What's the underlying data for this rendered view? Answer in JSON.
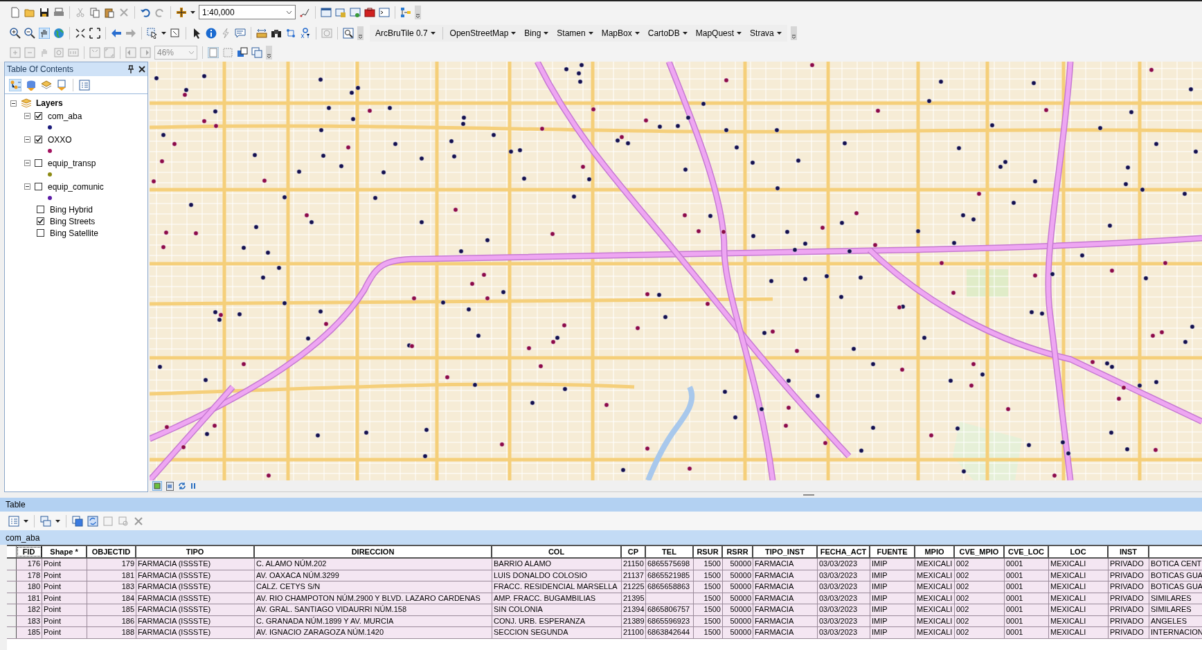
{
  "toolbar": {
    "scale": "1:40,000",
    "zoom": "46%",
    "menus": [
      "ArcBruTile 0.7",
      "OpenStreetMap",
      "Bing",
      "Stamen",
      "MapBox",
      "CartoDB",
      "MapQuest",
      "Strava"
    ]
  },
  "toc": {
    "title": "Table Of Contents",
    "root": "Layers",
    "layers": [
      {
        "kind": "layer",
        "label": "com_aba",
        "checked": true,
        "expanded": true,
        "color": "#1a1a7a"
      },
      {
        "kind": "layer",
        "label": "OXXO",
        "checked": true,
        "expanded": true,
        "color": "#a3125f"
      },
      {
        "kind": "layer",
        "label": "equip_transp",
        "checked": false,
        "expanded": true,
        "color": "#8c8a12"
      },
      {
        "kind": "layer",
        "label": "equip_comunic",
        "checked": false,
        "expanded": true,
        "color": "#5b1aa6"
      },
      {
        "kind": "basemap",
        "label": "Bing Hybrid",
        "checked": false
      },
      {
        "kind": "basemap",
        "label": "Bing Streets",
        "checked": true
      },
      {
        "kind": "basemap",
        "label": "Bing Satellite",
        "checked": false
      }
    ]
  },
  "table": {
    "title": "Table",
    "tab": "com_aba",
    "columns": [
      "FID",
      "Shape *",
      "OBJECTID",
      "TIPO",
      "DIRECCION",
      "COL",
      "CP",
      "TEL",
      "RSUR",
      "RSRR",
      "TIPO_INST",
      "FECHA_ACT",
      "FUENTE",
      "MPIO",
      "CVE_MPIO",
      "CVE_LOC",
      "LOC",
      "INST"
    ],
    "rows": [
      [
        "176",
        "Point",
        "179",
        "FARMACIA (ISSSTE)",
        "C. ALAMO NÚM.202",
        "BARRIO ALAMO",
        "21150",
        "6865575698",
        "1500",
        "50000",
        "FARMACIA",
        "03/03/2023",
        "IMIP",
        "MEXICALI",
        "002",
        "0001",
        "MEXICALI",
        "PRIVADO",
        "BOTICA CENT"
      ],
      [
        "178",
        "Point",
        "181",
        "FARMACIA (ISSSTE)",
        "AV. OAXACA NÚM.3299",
        "LUIS DONALDO COLOSIO",
        "21137",
        "6865521985",
        "1500",
        "50000",
        "FARMACIA",
        "03/03/2023",
        "IMIP",
        "MEXICALI",
        "002",
        "0001",
        "MEXICALI",
        "PRIVADO",
        "BOTICAS GUA"
      ],
      [
        "180",
        "Point",
        "183",
        "FARMACIA (ISSSTE)",
        "CALZ. CETYS S/N",
        "FRACC. RESIDENCIAL MARSELLA",
        "21225",
        "6865658863",
        "1500",
        "50000",
        "FARMACIA",
        "03/03/2023",
        "IMIP",
        "MEXICALI",
        "002",
        "0001",
        "MEXICALI",
        "PRIVADO",
        "BOTICAS GUA"
      ],
      [
        "181",
        "Point",
        "184",
        "FARMACIA (ISSSTE)",
        "AV. RIO CHAMPOTON NÚM.2900 Y BLVD. LAZARO CARDENAS",
        "AMP. FRACC. BUGAMBILIAS",
        "21395",
        "",
        "1500",
        "50000",
        "FARMACIA",
        "03/03/2023",
        "IMIP",
        "MEXICALI",
        "002",
        "0001",
        "MEXICALI",
        "PRIVADO",
        "SIMILARES"
      ],
      [
        "182",
        "Point",
        "185",
        "FARMACIA (ISSSTE)",
        "AV. GRAL. SANTIAGO VIDAURRI NÚM.158",
        "SIN COLONIA",
        "21394",
        "6865806757",
        "1500",
        "50000",
        "FARMACIA",
        "03/03/2023",
        "IMIP",
        "MEXICALI",
        "002",
        "0001",
        "MEXICALI",
        "PRIVADO",
        "SIMILARES"
      ],
      [
        "183",
        "Point",
        "186",
        "FARMACIA (ISSSTE)",
        "C. GRANADA NÚM.1899 Y AV. MURCIA",
        "CONJ. URB. ESPERANZA",
        "21389",
        "6865596923",
        "1500",
        "50000",
        "FARMACIA",
        "03/03/2023",
        "IMIP",
        "MEXICALI",
        "002",
        "0001",
        "MEXICALI",
        "PRIVADO",
        "ANGELES"
      ],
      [
        "185",
        "Point",
        "188",
        "FARMACIA (ISSSTE)",
        "AV. IGNACIO ZARAGOZA NÚM.1420",
        "SECCION SEGUNDA",
        "21100",
        "6863842644",
        "1500",
        "50000",
        "FARMACIA",
        "03/03/2023",
        "IMIP",
        "MEXICALI",
        "002",
        "0001",
        "MEXICALI",
        "PRIVADO",
        "INTERNACION"
      ]
    ]
  }
}
